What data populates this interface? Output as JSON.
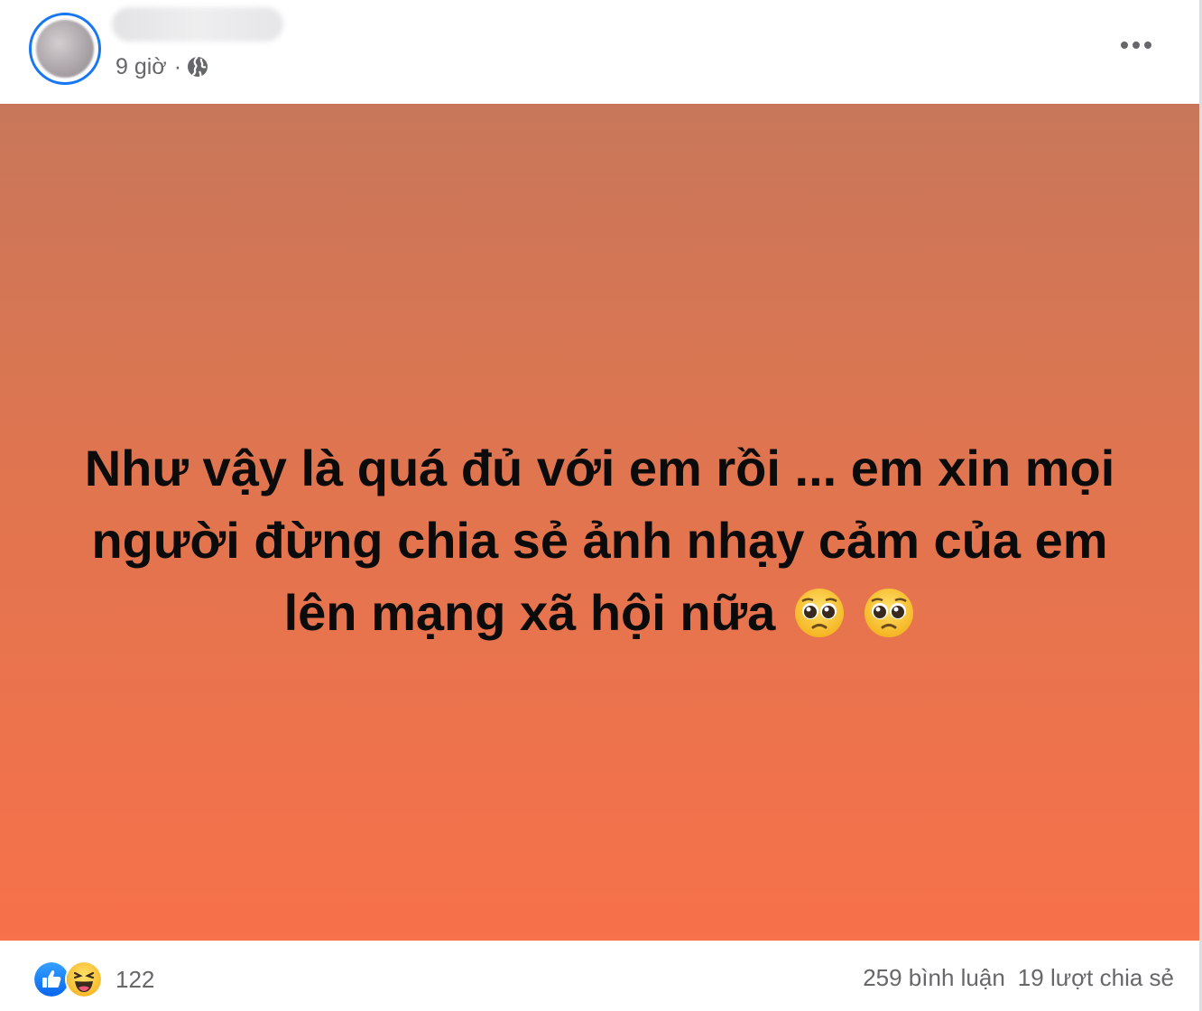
{
  "header": {
    "time": "9 giờ",
    "separator": "·",
    "privacy_icon": "globe-icon",
    "more_icon": "more-horizontal-icon"
  },
  "post": {
    "text": "Như vậy là quá đủ với em rồi ... em xin mọi người đừng chia sẻ ảnh nhạy cảm của em lên mạng xã hội nữa",
    "emoji": [
      "pleading-face",
      "pleading-face"
    ],
    "background_gradient": [
      "#c8775a",
      "#f7714a"
    ]
  },
  "footer": {
    "reaction_icons": [
      "like-icon",
      "haha-icon"
    ],
    "reaction_count": "122",
    "comments": "259 bình luận",
    "shares": "19 lượt chia sẻ"
  },
  "colors": {
    "accent": "#1877f2",
    "secondary_text": "#65676b"
  }
}
